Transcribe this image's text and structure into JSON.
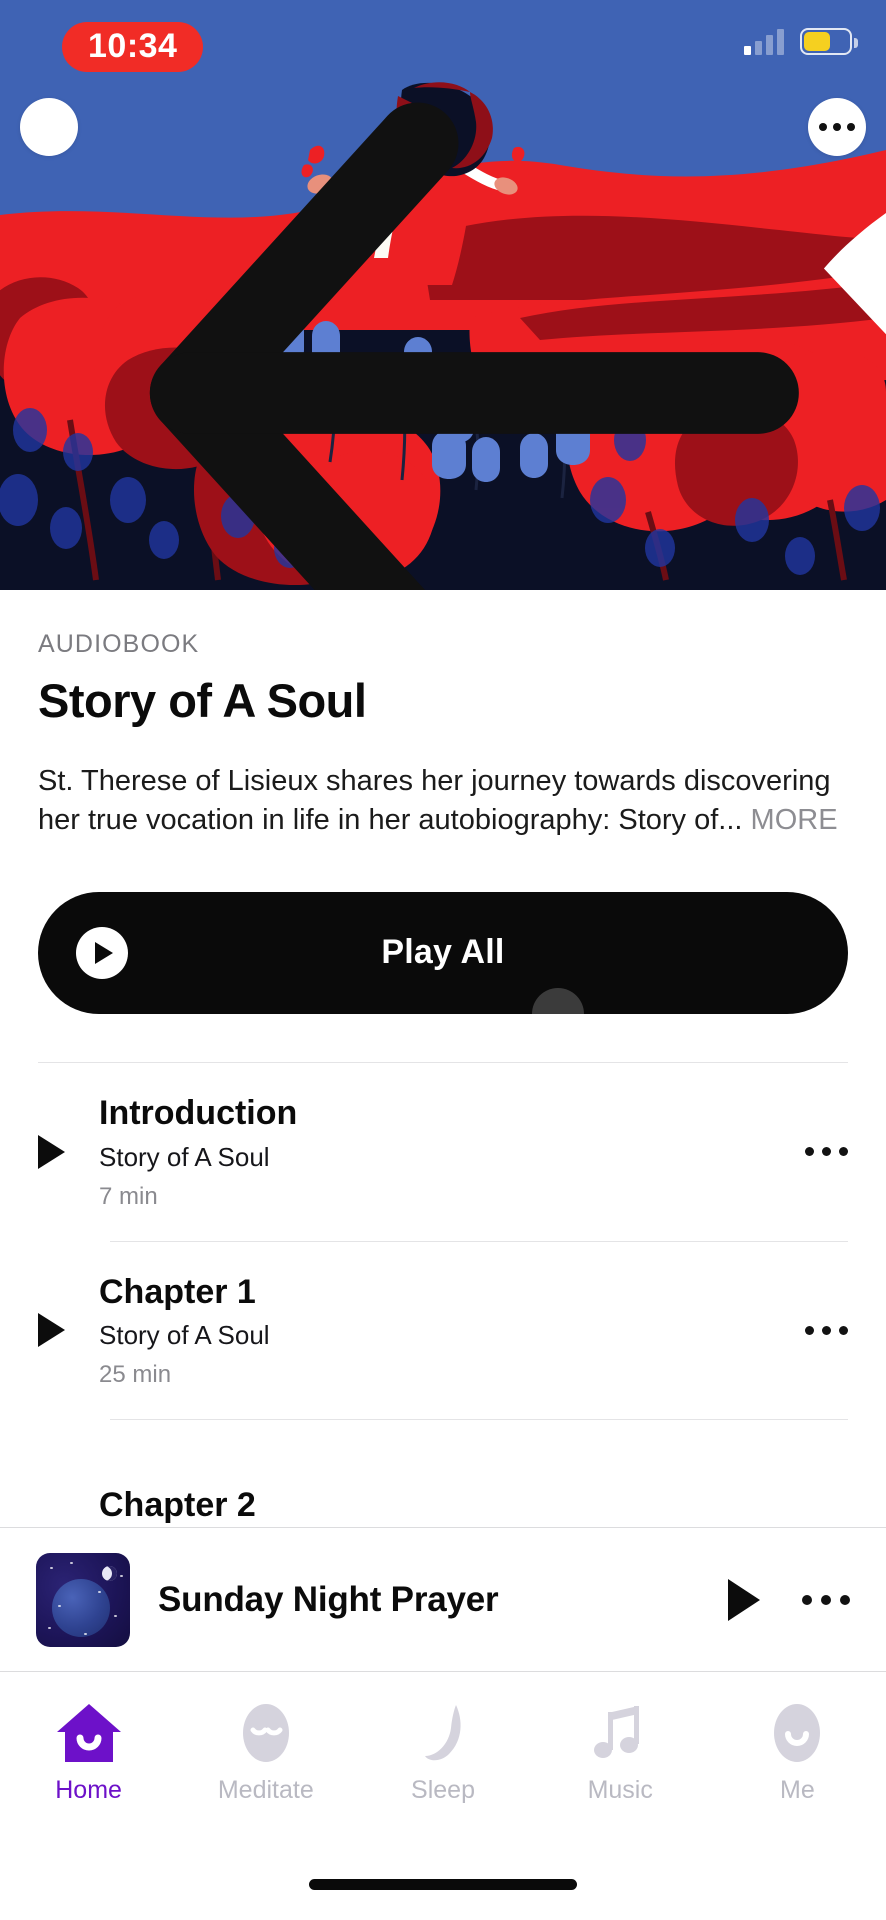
{
  "statusbar": {
    "time": "10:34",
    "time_pill_color": "#f12c26",
    "signal_icon": "cellular-signal-icon",
    "wifi_icon": "wifi-icon",
    "battery_icon": "battery-icon",
    "battery_fill_color": "#f5d020",
    "battery_level_percent": "55"
  },
  "hero": {
    "back_icon": "back-arrow-icon",
    "more_icon": "more-options-icon",
    "sky_color": "#3f63b4",
    "flower_color": "#ed2024",
    "ground_color": "#0b1026",
    "bell_color": "#4f73c8",
    "alt": "Illustration of a figure in a red dress among red poppies and blue bellflowers"
  },
  "detail": {
    "kicker": "AUDIOBOOK",
    "title": "Story of A Soul",
    "description": "St. Therese of Lisieux shares her journey towards discovering her true vocation in life in her autobiography: Story of...",
    "more_label": "MORE"
  },
  "play_all": {
    "label": "Play All",
    "play_icon": "play-icon",
    "background_color": "#0a0a0a"
  },
  "chapters": [
    {
      "play_icon": "play-icon",
      "title": "Introduction",
      "subtitle": "Story of A Soul",
      "duration": "7 min",
      "more_icon": "more-options-icon"
    },
    {
      "play_icon": "play-icon",
      "title": "Chapter 1",
      "subtitle": "Story of A Soul",
      "duration": "25 min",
      "more_icon": "more-options-icon"
    },
    {
      "play_icon": "play-icon",
      "title": "Chapter 2",
      "subtitle": "",
      "duration": "",
      "more_icon": "more-options-icon"
    }
  ],
  "mini_player": {
    "thumbnail_icon": "night-sky-planet-thumbnail",
    "title": "Sunday Night Prayer",
    "play_icon": "play-icon",
    "more_icon": "more-options-icon"
  },
  "tabbar": {
    "active_color": "#6d11c9",
    "inactive_color": "#b9b9c2",
    "items": [
      {
        "label": "Home",
        "icon": "home-icon",
        "active": true
      },
      {
        "label": "Meditate",
        "icon": "meditate-face-icon",
        "active": false
      },
      {
        "label": "Sleep",
        "icon": "moon-icon",
        "active": false
      },
      {
        "label": "Music",
        "icon": "music-note-icon",
        "active": false
      },
      {
        "label": "Me",
        "icon": "profile-face-icon",
        "active": false
      }
    ]
  }
}
